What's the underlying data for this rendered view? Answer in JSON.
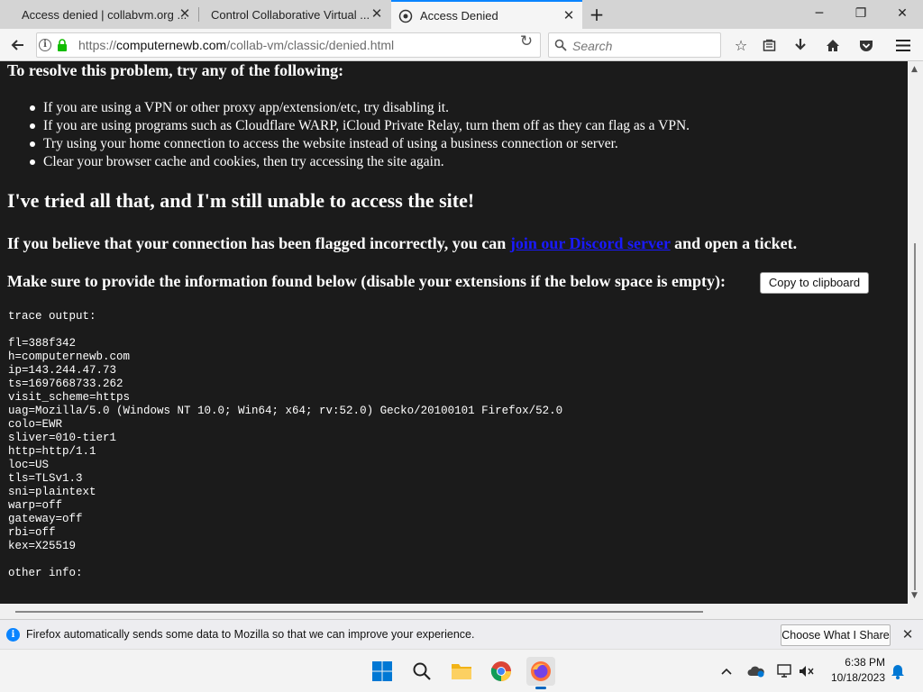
{
  "browser": {
    "tabs": [
      {
        "label": "Access denied | collabvm.org ...",
        "active": false
      },
      {
        "label": "Control Collaborative Virtual ...",
        "active": false
      },
      {
        "label": "Access Denied",
        "active": true
      }
    ],
    "url_prefix": "https://",
    "url_host": "computernewb.com",
    "url_path": "/collab-vm/classic/denied.html",
    "search_placeholder": "Search"
  },
  "page": {
    "resolve_heading": "To resolve this problem, try any of the following:",
    "bullets": [
      "If you are using a VPN or other proxy app/extension/etc, try disabling it.",
      "If you are using programs such as Cloudflare WARP, iCloud Private Relay, turn them off as they can flag as a VPN.",
      "Try using your home connection to access the website instead of using a business connection or server.",
      "Clear your browser cache and cookies, then try accessing the site again."
    ],
    "tried_heading": "I've tried all that, and I'm still unable to access the site!",
    "flag_text_before": "If you believe that your connection has been flagged incorrectly, you can ",
    "flag_link": "join our Discord server",
    "flag_text_after": " and open a ticket.",
    "make_sure_text": "Make sure to provide the information found below (disable your extensions if the below space is empty):",
    "copy_button": "Copy to clipboard",
    "trace_lines": [
      "trace output:",
      "",
      "fl=388f342",
      "h=computernewb.com",
      "ip=143.244.47.73",
      "ts=1697668733.262",
      "visit_scheme=https",
      "uag=Mozilla/5.0 (Windows NT 10.0; Win64; x64; rv:52.0) Gecko/20100101 Firefox/52.0",
      "colo=EWR",
      "sliver=010-tier1",
      "http=http/1.1",
      "loc=US",
      "tls=TLSv1.3",
      "sni=plaintext",
      "warp=off",
      "gateway=off",
      "rbi=off",
      "kex=X25519",
      "",
      "other info:"
    ]
  },
  "notification": {
    "text": "Firefox automatically sends some data to Mozilla so that we can improve your experience.",
    "button": "Choose What I Share"
  },
  "taskbar": {
    "time": "6:38 PM",
    "date": "10/18/2023"
  },
  "colors": {
    "page_background": "#1b1b1b",
    "link": "#1a1aff",
    "accent": "#0a84ff"
  }
}
